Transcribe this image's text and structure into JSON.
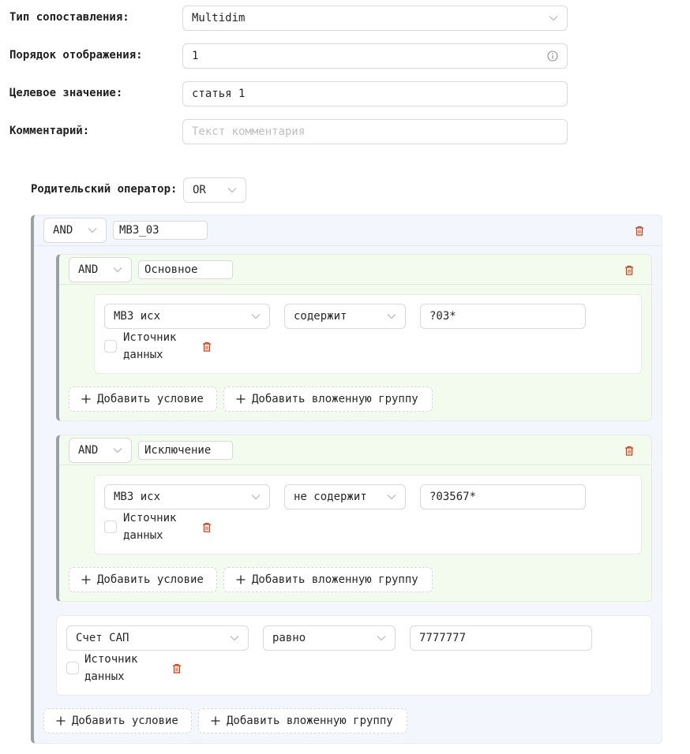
{
  "form": {
    "match_type": {
      "label": "Тип сопоставления:",
      "value": "Multidim"
    },
    "display_order": {
      "label": "Порядок отображения:",
      "value": "1"
    },
    "target_value": {
      "label": "Целевое значение:",
      "value": "статья 1"
    },
    "comment": {
      "label": "Комментарий:",
      "placeholder": "Текст комментария"
    }
  },
  "parent_operator": {
    "label": "Родительский оператор:",
    "value": "OR"
  },
  "root_group": {
    "operator": "AND",
    "name": "MB3_03",
    "groups": [
      {
        "operator": "AND",
        "name": "Основное",
        "condition": {
          "field": "MB3 исх",
          "op": "содержит",
          "value": "?03*",
          "checkbox_label_line1": "Источник",
          "checkbox_label_line2": "данных"
        },
        "add_condition": "Добавить условие",
        "add_group": "Добавить вложенную группу"
      },
      {
        "operator": "AND",
        "name": "Исключение",
        "condition": {
          "field": "MB3 исх",
          "op": "не содержит",
          "value": "?03567*",
          "checkbox_label_line1": "Источник",
          "checkbox_label_line2": "данных"
        },
        "add_condition": "Добавить условие",
        "add_group": "Добавить вложенную группу"
      }
    ],
    "condition": {
      "field": "Счет САП",
      "op": "равно",
      "value": "7777777",
      "checkbox_label_line1": "Источник",
      "checkbox_label_line2": "данных"
    },
    "add_condition": "Добавить условие",
    "add_group": "Добавить вложенную группу"
  },
  "colors": {
    "delete_icon": "#d4380d",
    "group_border": "#9aa0a6",
    "outer_bg": "#f3f7fd",
    "inner_bg": "#f3fbef"
  }
}
